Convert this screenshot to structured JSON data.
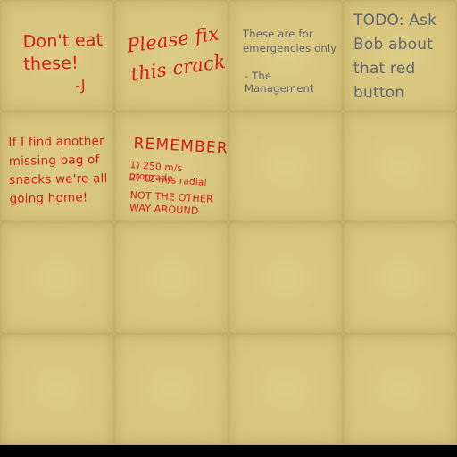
{
  "board": {
    "notes": [
      {
        "text": "Don't eat\nthese!",
        "signature": "-J",
        "color": "#d6191b"
      },
      {
        "text": "Please fix\nthis crack",
        "color": "#d6191b"
      },
      {
        "text": "These are for\nemergencies only",
        "signature": "- The Management",
        "color": "#5f6470"
      },
      {
        "text": "TODO: Ask\nBob  about\nthat red\nbutton",
        "color": "#5f6470"
      },
      {
        "text": "If I find another\nmissing bag of\nsnacks we're all\ngoing home!",
        "color": "#d6191b"
      },
      {
        "title": "REMEMBER",
        "line1": "1) 250 m/s prograde",
        "line2": "2) 12 m/s radial",
        "line3": "NOT THE OTHER\nWAY AROUND",
        "color": "#d6191b"
      }
    ]
  },
  "colors": {
    "board_tan": "#d5c27a",
    "ink_red": "#d6191b",
    "ink_gray": "#5f6470",
    "bottom_bar": "#000000"
  }
}
